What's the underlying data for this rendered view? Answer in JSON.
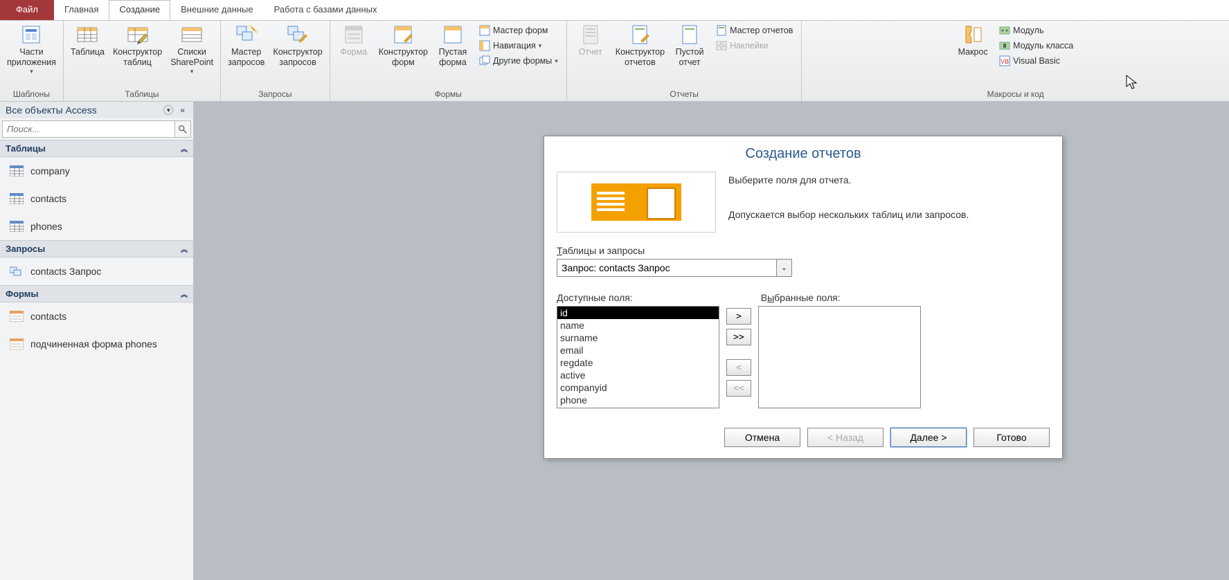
{
  "tabs": {
    "file": "Файл",
    "home": "Главная",
    "create": "Создание",
    "ext": "Внешние данные",
    "db": "Работа с базами данных"
  },
  "ribbon": {
    "templates": {
      "parts": "Части\nприложения",
      "label": "Шаблоны"
    },
    "tables": {
      "table": "Таблица",
      "designer": "Конструктор\nтаблиц",
      "sharepoint": "Списки\nSharePoint",
      "label": "Таблицы"
    },
    "queries": {
      "wizard": "Мастер\nзапросов",
      "designer": "Конструктор\nзапросов",
      "label": "Запросы"
    },
    "forms": {
      "form": "Форма",
      "designer": "Конструктор\nформ",
      "blank": "Пустая\nформа",
      "wizard": "Мастер форм",
      "nav": "Навигация",
      "other": "Другие формы",
      "label": "Формы"
    },
    "reports": {
      "report": "Отчет",
      "designer": "Конструктор\nотчетов",
      "blank": "Пустой\nотчет",
      "wizard": "Мастер отчетов",
      "labels": "Наклейки",
      "label": "Отчеты"
    },
    "macros": {
      "macro": "Макрос",
      "module": "Модуль",
      "class": "Модуль класса",
      "vb": "Visual Basic",
      "label": "Макросы и код"
    }
  },
  "nav": {
    "title": "Все объекты Access",
    "search_ph": "Поиск...",
    "sections": {
      "tables": {
        "label": "Таблицы",
        "items": [
          "company",
          "contacts",
          "phones"
        ]
      },
      "queries": {
        "label": "Запросы",
        "items": [
          "contacts Запрос"
        ]
      },
      "forms": {
        "label": "Формы",
        "items": [
          "contacts",
          "подчиненная форма phones"
        ]
      }
    }
  },
  "wizard": {
    "title": "Создание отчетов",
    "desc1": "Выберите поля для отчета.",
    "desc2": "Допускается выбор нескольких таблиц или запросов.",
    "tq_label": "Таблицы и запросы",
    "tq_value": "Запрос: contacts Запрос",
    "avail_label": "Доступные поля:",
    "sel_label": "Выбранные поля:",
    "avail": [
      "id",
      "name",
      "surname",
      "email",
      "regdate",
      "active",
      "companyid",
      "phone"
    ],
    "btn_add": ">",
    "btn_addall": ">>",
    "btn_rem": "<",
    "btn_remall": "<<",
    "cancel": "Отмена",
    "back": "< Назад",
    "next": "Далее >",
    "finish": "Готово"
  }
}
